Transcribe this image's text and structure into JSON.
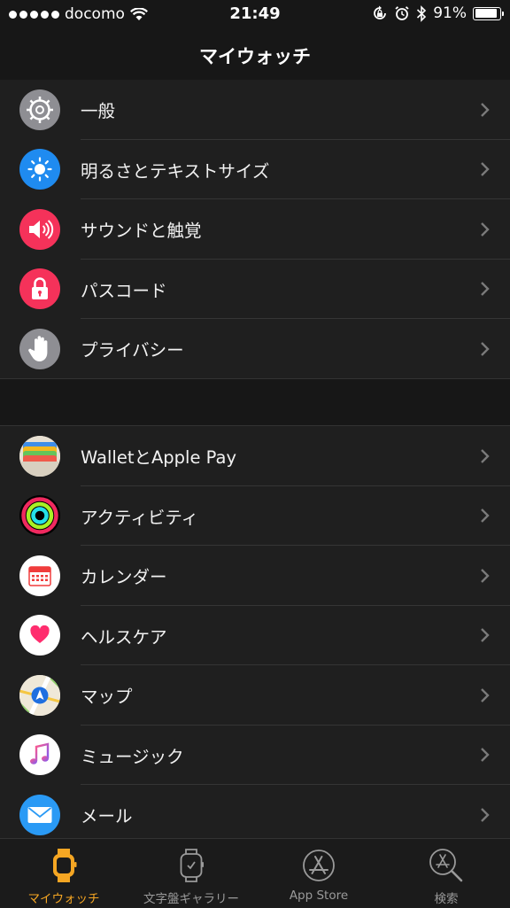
{
  "status": {
    "carrier": "docomo",
    "time": "21:49",
    "battery": "91%",
    "battery_level": 0.91
  },
  "header": {
    "title": "マイウォッチ"
  },
  "sections": [
    {
      "items": [
        {
          "label": "一般",
          "icon": "gear-icon"
        },
        {
          "label": "明るさとテキストサイズ",
          "icon": "brightness-icon"
        },
        {
          "label": "サウンドと触覚",
          "icon": "speaker-icon"
        },
        {
          "label": "パスコード",
          "icon": "lock-icon"
        },
        {
          "label": "プライバシー",
          "icon": "hand-icon"
        }
      ]
    },
    {
      "items": [
        {
          "label": "WalletとApple Pay",
          "icon": "wallet-icon"
        },
        {
          "label": "アクティビティ",
          "icon": "activity-icon"
        },
        {
          "label": "カレンダー",
          "icon": "calendar-icon"
        },
        {
          "label": "ヘルスケア",
          "icon": "health-icon"
        },
        {
          "label": "マップ",
          "icon": "map-icon"
        },
        {
          "label": "ミュージック",
          "icon": "music-icon"
        },
        {
          "label": "メール",
          "icon": "mail-icon"
        }
      ]
    }
  ],
  "tabs": [
    {
      "label": "マイウォッチ",
      "icon": "watch-icon",
      "active": true
    },
    {
      "label": "文字盤ギャラリー",
      "icon": "watch-face-icon",
      "active": false
    },
    {
      "label": "App Store",
      "icon": "app-store-icon",
      "active": false
    },
    {
      "label": "検索",
      "icon": "search-icon",
      "active": false
    }
  ],
  "colors": {
    "accent": "#f5a623",
    "background": "#1f1f1f"
  }
}
